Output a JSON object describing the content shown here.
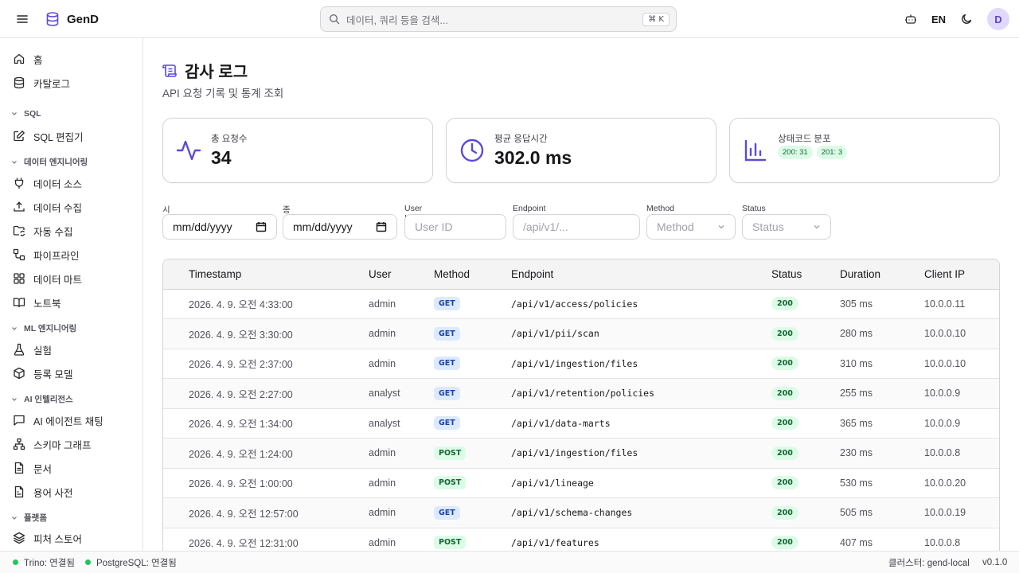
{
  "app": {
    "name": "GenD"
  },
  "topbar": {
    "search_placeholder": "데이터, 쿼리 등을 검색...",
    "shortcut": "⌘ K",
    "language": "EN",
    "avatar_initial": "D"
  },
  "sidebar": {
    "items": [
      {
        "label": "홈",
        "icon": "home-icon"
      },
      {
        "label": "카탈로그",
        "icon": "database-icon"
      },
      {
        "label": "SQL 편집기",
        "icon": "edit-icon"
      },
      {
        "label": "데이터 소스",
        "icon": "plug-icon"
      },
      {
        "label": "데이터 수집",
        "icon": "upload-icon"
      },
      {
        "label": "자동 수집",
        "icon": "folder-sync-icon"
      },
      {
        "label": "파이프라인",
        "icon": "workflow-icon"
      },
      {
        "label": "데이터 마트",
        "icon": "grid-icon"
      },
      {
        "label": "노트북",
        "icon": "book-open-icon"
      },
      {
        "label": "실험",
        "icon": "flask-icon"
      },
      {
        "label": "등록 모델",
        "icon": "package-icon"
      },
      {
        "label": "AI 에이전트 채팅",
        "icon": "chat-icon"
      },
      {
        "label": "스키마 그래프",
        "icon": "network-icon"
      },
      {
        "label": "문서",
        "icon": "document-icon"
      },
      {
        "label": "용어 사전",
        "icon": "dictionary-icon"
      },
      {
        "label": "피처 스토어",
        "icon": "layers-icon"
      }
    ],
    "sections": [
      "SQL",
      "데이터 엔지니어링",
      "ML 엔지니어링",
      "AI 인텔리전스",
      "플랫폼"
    ]
  },
  "page": {
    "title": "감사 로그",
    "subtitle": "API 요청 기록 및 통계 조회"
  },
  "stats": {
    "total_label": "총 요청수",
    "total_value": "34",
    "avg_label": "평균 응답시간",
    "avg_value": "302.0 ms",
    "status_label": "상태코드 분포",
    "status_pills": [
      "200: 31",
      "201: 3"
    ]
  },
  "filters": {
    "start_label": "시작일",
    "start_value": "mm/dd/yyyy",
    "end_label": "종료일",
    "end_value": "mm/dd/yyyy",
    "user_label": "User ID",
    "user_placeholder": "User ID",
    "endpoint_label": "Endpoint",
    "endpoint_placeholder": "/api/v1/...",
    "method_label": "Method",
    "method_value": "Method",
    "status_label": "Status",
    "status_value": "Status"
  },
  "table": {
    "columns": [
      "Timestamp",
      "User",
      "Method",
      "Endpoint",
      "Status",
      "Duration",
      "Client IP"
    ],
    "rows": [
      {
        "ts": "2026. 4. 9. 오전 4:33:00",
        "user": "admin",
        "method": "GET",
        "endpoint": "/api/v1/access/policies",
        "status": "200",
        "duration": "305 ms",
        "ip": "10.0.0.11"
      },
      {
        "ts": "2026. 4. 9. 오전 3:30:00",
        "user": "admin",
        "method": "GET",
        "endpoint": "/api/v1/pii/scan",
        "status": "200",
        "duration": "280 ms",
        "ip": "10.0.0.10"
      },
      {
        "ts": "2026. 4. 9. 오전 2:37:00",
        "user": "admin",
        "method": "GET",
        "endpoint": "/api/v1/ingestion/files",
        "status": "200",
        "duration": "310 ms",
        "ip": "10.0.0.10"
      },
      {
        "ts": "2026. 4. 9. 오전 2:27:00",
        "user": "analyst",
        "method": "GET",
        "endpoint": "/api/v1/retention/policies",
        "status": "200",
        "duration": "255 ms",
        "ip": "10.0.0.9"
      },
      {
        "ts": "2026. 4. 9. 오전 1:34:00",
        "user": "analyst",
        "method": "GET",
        "endpoint": "/api/v1/data-marts",
        "status": "200",
        "duration": "365 ms",
        "ip": "10.0.0.9"
      },
      {
        "ts": "2026. 4. 9. 오전 1:24:00",
        "user": "admin",
        "method": "POST",
        "endpoint": "/api/v1/ingestion/files",
        "status": "200",
        "duration": "230 ms",
        "ip": "10.0.0.8"
      },
      {
        "ts": "2026. 4. 9. 오전 1:00:00",
        "user": "admin",
        "method": "POST",
        "endpoint": "/api/v1/lineage",
        "status": "200",
        "duration": "530 ms",
        "ip": "10.0.0.20"
      },
      {
        "ts": "2026. 4. 9. 오전 12:57:00",
        "user": "admin",
        "method": "GET",
        "endpoint": "/api/v1/schema-changes",
        "status": "200",
        "duration": "505 ms",
        "ip": "10.0.0.19"
      },
      {
        "ts": "2026. 4. 9. 오전 12:31:00",
        "user": "admin",
        "method": "POST",
        "endpoint": "/api/v1/features",
        "status": "200",
        "duration": "407 ms",
        "ip": "10.0.0.8"
      }
    ]
  },
  "footer": {
    "trino": "Trino: 연결됨",
    "postgres": "PostgreSQL: 연결됨",
    "cluster": "클러스터: gend-local",
    "version": "v0.1.0"
  },
  "colors": {
    "accent": "#5b4bd5",
    "connected": "#22c55e"
  }
}
